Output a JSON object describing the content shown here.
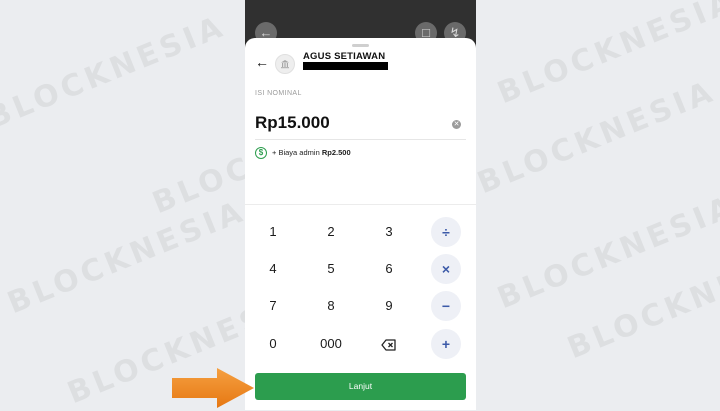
{
  "watermark": "BLOCKNESIA",
  "recipient": {
    "name": "AGUS SETIAWAN"
  },
  "amount_section": {
    "label": "ISI NOMINAL",
    "amount": "Rp15.000",
    "fee_prefix": "+ Biaya admin",
    "fee_value": "Rp2.500"
  },
  "keypad": {
    "rows": [
      [
        "1",
        "2",
        "3"
      ],
      [
        "4",
        "5",
        "6"
      ],
      [
        "7",
        "8",
        "9"
      ],
      [
        "0",
        "000"
      ]
    ],
    "operators": [
      "÷",
      "×",
      "−",
      "+"
    ]
  },
  "button": {
    "label": "Lanjut"
  },
  "colors": {
    "primary": "#2c9d4e",
    "accent": "#3c5aa8",
    "arrow": "#f08a24"
  },
  "icons": [
    "back-arrow-icon",
    "bank-icon",
    "clear-icon",
    "fee-icon",
    "backspace-icon"
  ]
}
